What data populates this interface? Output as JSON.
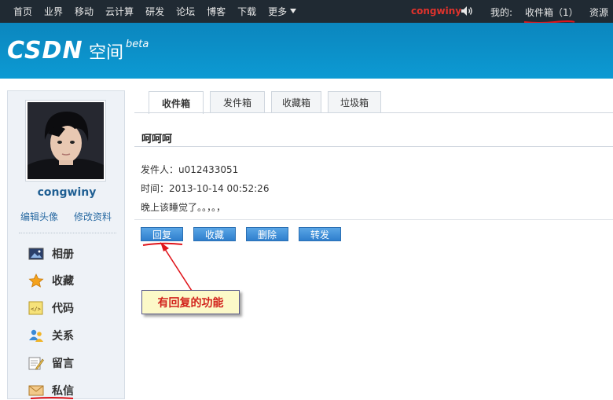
{
  "topbar": {
    "nav": [
      "首页",
      "业界",
      "移动",
      "云计算",
      "研发",
      "论坛",
      "博客",
      "下载",
      "更多"
    ],
    "username": "congwiny",
    "mine_label": "我的:",
    "inbox_label": "收件箱（1）",
    "resources_label": "资源"
  },
  "header": {
    "logo": "CSDN",
    "logo_sub": "空间",
    "logo_beta": "beta"
  },
  "sidebar": {
    "username": "congwiny",
    "edit_avatar": "编辑头像",
    "edit_profile": "修改资料",
    "items": [
      {
        "label": "相册",
        "icon": "photo-album-icon"
      },
      {
        "label": "收藏",
        "icon": "star-icon"
      },
      {
        "label": "代码",
        "icon": "code-icon"
      },
      {
        "label": "关系",
        "icon": "people-icon"
      },
      {
        "label": "留言",
        "icon": "note-pencil-icon"
      },
      {
        "label": "私信",
        "icon": "envelope-icon"
      }
    ]
  },
  "tabs": [
    "收件箱",
    "发件箱",
    "收藏箱",
    "垃圾箱"
  ],
  "message": {
    "subject": "呵呵呵",
    "sender": "发件人：u012433051",
    "time": "时间：2013-10-14 00:52:26",
    "body": "晚上该睡觉了。。，。，"
  },
  "actions": {
    "reply": "回复",
    "favorite": "收藏",
    "delete": "删除",
    "forward": "转发"
  },
  "annotation": {
    "callout": "有回复的功能"
  },
  "colors": {
    "topbar": "#202a33",
    "header": "#0d9ad3",
    "username_red": "#e0322c",
    "annotation_red": "#e0151b"
  }
}
